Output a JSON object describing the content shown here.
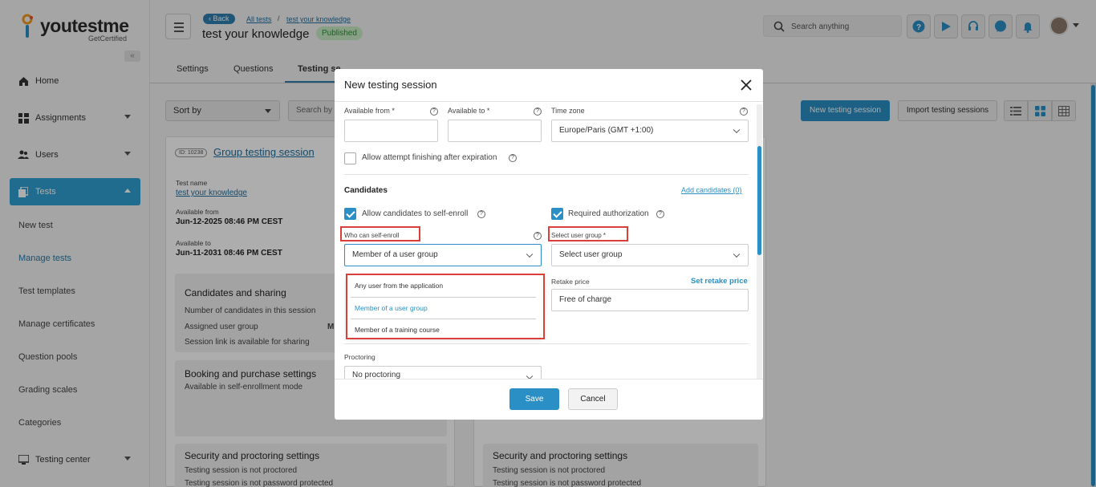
{
  "logo": {
    "word": "youtestme",
    "tagline": "GetCertified"
  },
  "sidebar": {
    "collapse_icon": "«",
    "items": [
      {
        "label": "Home",
        "icon": "home-icon"
      },
      {
        "label": "Assignments",
        "icon": "assignments-icon"
      },
      {
        "label": "Users",
        "icon": "users-icon"
      },
      {
        "label": "Tests",
        "icon": "tests-icon"
      }
    ],
    "sub_items": [
      "New test",
      "Manage tests",
      "Test templates",
      "Manage certificates",
      "Question pools",
      "Grading scales",
      "Categories"
    ],
    "testing_center": "Testing center"
  },
  "header": {
    "back": "Back",
    "crumb1": "All tests",
    "sep": "/",
    "crumb2": "test your knowledge",
    "title": "test your knowledge",
    "status": "Published",
    "search_placeholder": "Search anything"
  },
  "tabs": [
    "Settings",
    "Questions",
    "Testing se"
  ],
  "toolbar": {
    "sort_by": "Sort by",
    "search": "Search by s",
    "new_session": "New testing session",
    "import_sessions": "Import testing sessions"
  },
  "card": {
    "id_badge": "ID: 10238",
    "title": "Group testing session",
    "test_name_label": "Test name",
    "test_name": "test your knowledge",
    "available_from_label": "Available from",
    "available_from": "Jun-12-2025 08:46 PM CEST",
    "available_to_label": "Available to",
    "available_to": "Jun-11-2031 08:46 PM CEST",
    "candidates_heading": "Candidates and sharing",
    "candidates_lines": [
      "Number of candidates in this session",
      "Assigned user group",
      "Session link is available for sharing"
    ],
    "assigned_value": "M",
    "booking_heading": "Booking and purchase settings",
    "booking_line": "Available in self-enrollment mode",
    "security_heading": "Security and proctoring settings",
    "security_lines": [
      "Testing session is not proctored",
      "Testing session is not password protected"
    ]
  },
  "card2": {
    "security_heading": "Security and proctoring settings",
    "security_lines": [
      "Testing session is not proctored",
      "Testing session is not password protected"
    ]
  },
  "modal": {
    "title": "New testing session",
    "available_from_label": "Available from *",
    "available_to_label": "Available to *",
    "timezone_label": "Time zone",
    "timezone_value": "Europe/Paris (GMT +1:00)",
    "allow_finish_label": "Allow attempt finishing after expiration",
    "candidates_heading": "Candidates",
    "add_candidates": "Add candidates (0)",
    "self_enroll_label": "Allow candidates to self-enroll",
    "required_auth_label": "Required authorization",
    "who_label": "Who can self-enroll",
    "who_value": "Member of a user group",
    "group_label": "Select user group *",
    "group_value": "Select user group",
    "dropdown_options": [
      "Any user from the application",
      "Member of a user group",
      "Member of a training course"
    ],
    "retake_label": "Retake price",
    "set_retake": "Set retake price",
    "retake_value": "Free of charge",
    "proctoring_label": "Proctoring",
    "proctoring_value": "No proctoring",
    "save": "Save",
    "cancel": "Cancel",
    "help_glyph": "?"
  },
  "colors": {
    "accent": "#2a8fc4",
    "highlight": "#d9403a",
    "published_bg": "#c8ecc4"
  }
}
